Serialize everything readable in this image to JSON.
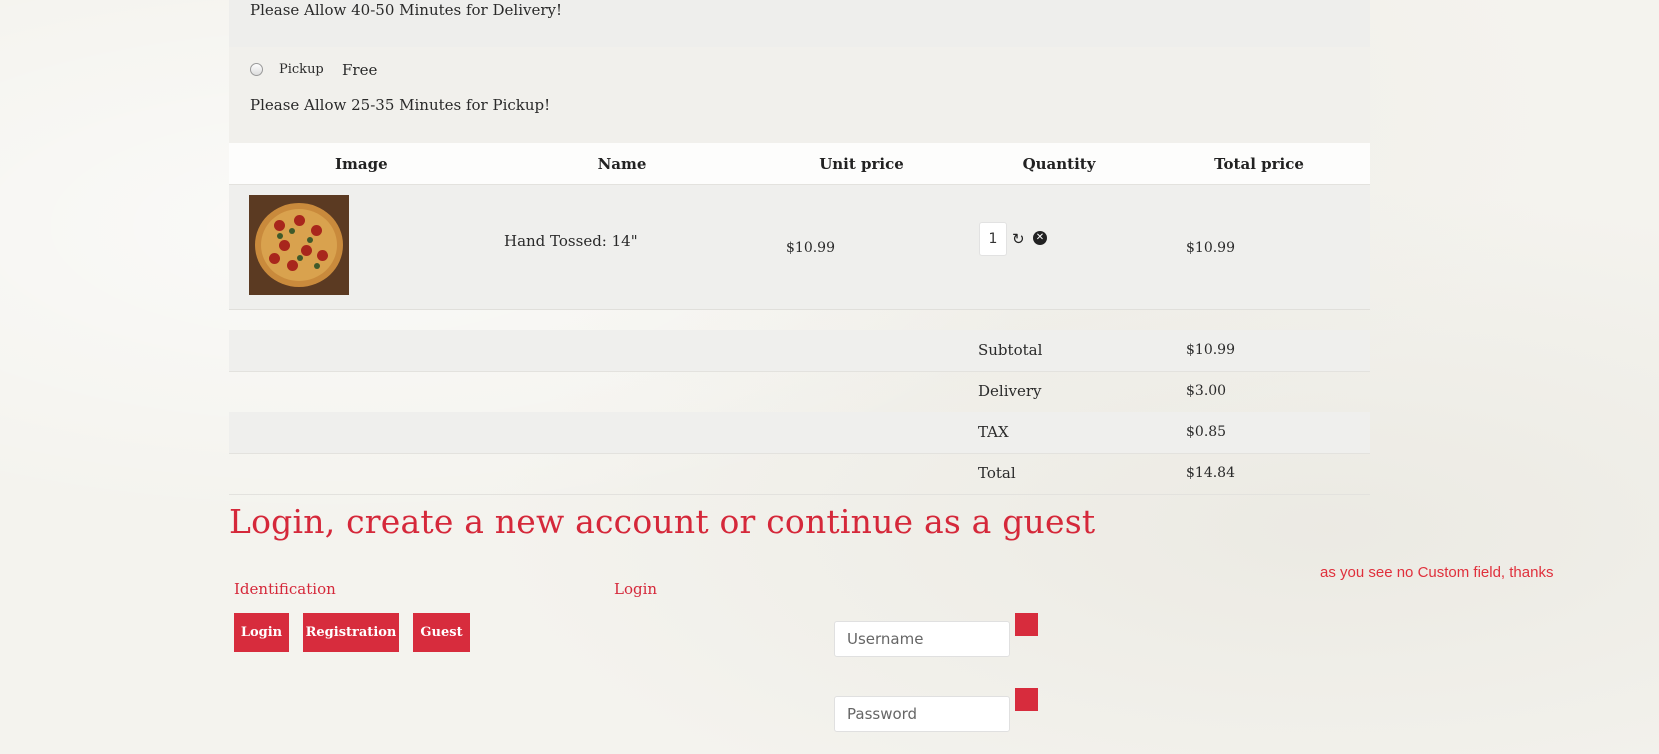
{
  "shipping": {
    "delivery_note": "Please Allow 40-50 Minutes for Delivery!",
    "pickup_label": "Pickup",
    "pickup_price": "Free",
    "pickup_note": "Please Allow 25-35 Minutes for Pickup!"
  },
  "cart": {
    "headers": [
      "Image",
      "Name",
      "Unit price",
      "Quantity",
      "Total price"
    ],
    "items": [
      {
        "image_icon": "pizza-image",
        "name": "Hand Tossed: 14\"",
        "unit_price": "$10.99",
        "quantity": "1",
        "total_price": "$10.99"
      }
    ],
    "icons": {
      "update": "refresh-icon",
      "remove": "remove-icon"
    }
  },
  "totals": [
    {
      "label": "Subtotal",
      "value": "$10.99"
    },
    {
      "label": "Delivery",
      "value": "$3.00"
    },
    {
      "label": "TAX",
      "value": "$0.85"
    },
    {
      "label": "Total",
      "value": "$14.84"
    }
  ],
  "account": {
    "heading": "Login, create a new account or continue as a guest",
    "note": "as you see no Custom field, thanks",
    "identification_label": "Identification",
    "login_label": "Login",
    "buttons": {
      "login": "Login",
      "registration": "Registration",
      "guest": "Guest"
    },
    "username_placeholder": "Username",
    "password_placeholder": "Password"
  },
  "colors": {
    "accent": "#d72c3d",
    "row_shade": "#efefed",
    "background": "#f4f3ee"
  }
}
